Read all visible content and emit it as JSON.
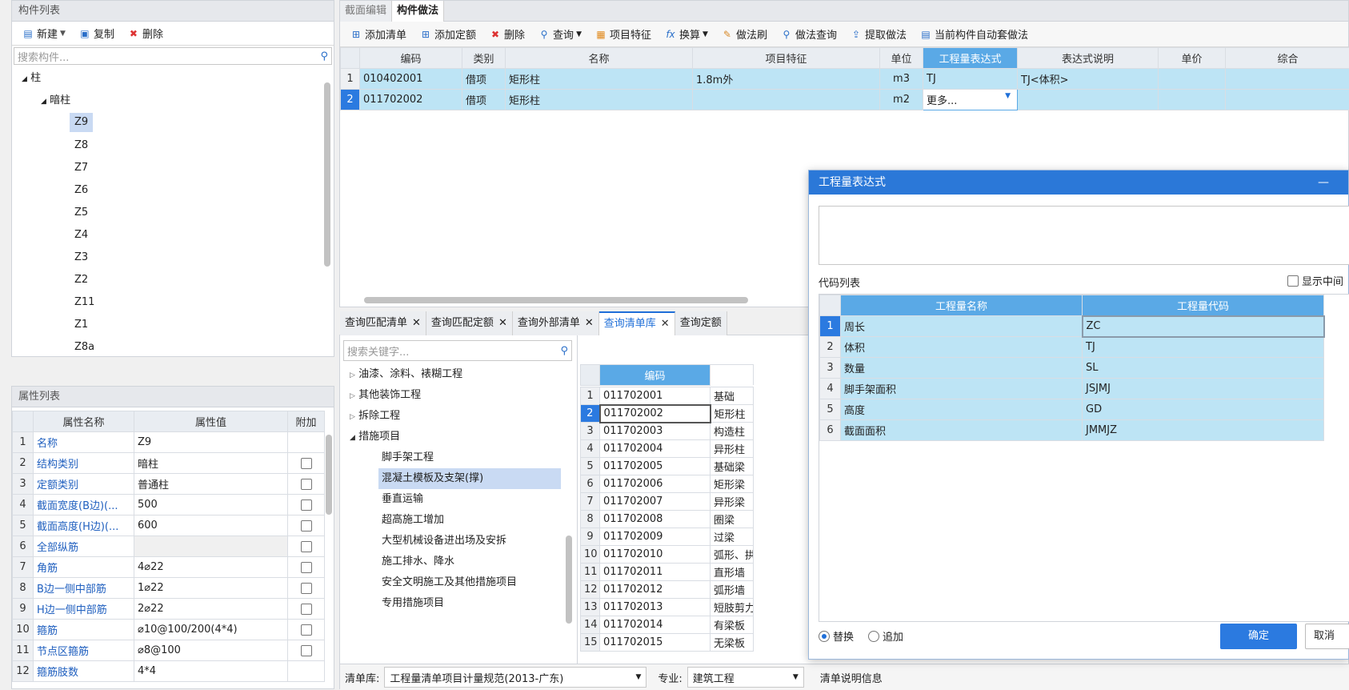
{
  "left_top": {
    "title": "构件列表",
    "new": "新建",
    "copy": "复制",
    "delete": "删除",
    "search_placeholder": "搜索构件...",
    "tree": {
      "root": "柱",
      "sub": "暗柱",
      "items": [
        "Z9",
        "Z8",
        "Z7",
        "Z6",
        "Z5",
        "Z4",
        "Z3",
        "Z2",
        "Z11",
        "Z1",
        "Z8a"
      ]
    }
  },
  "props": {
    "title": "属性列表",
    "headers": [
      "属性名称",
      "属性值",
      "附加"
    ],
    "rows": [
      {
        "n": "1",
        "name": "名称",
        "value": "Z9",
        "check": false
      },
      {
        "n": "2",
        "name": "结构类别",
        "value": "暗柱",
        "check": true
      },
      {
        "n": "3",
        "name": "定额类别",
        "value": "普通柱",
        "check": true
      },
      {
        "n": "4",
        "name": "截面宽度(B边)(...",
        "value": "500",
        "check": true
      },
      {
        "n": "5",
        "name": "截面高度(H边)(...",
        "value": "600",
        "check": true
      },
      {
        "n": "6",
        "name": "全部纵筋",
        "value": "",
        "check": true
      },
      {
        "n": "7",
        "name": "角筋",
        "value": "4⌀22",
        "check": true
      },
      {
        "n": "8",
        "name": "B边一侧中部筋",
        "value": "1⌀22",
        "check": true
      },
      {
        "n": "9",
        "name": "H边一侧中部筋",
        "value": "2⌀22",
        "check": true
      },
      {
        "n": "10",
        "name": "箍筋",
        "value": "⌀10@100/200(4*4)",
        "check": true
      },
      {
        "n": "11",
        "name": "节点区箍筋",
        "value": "⌀8@100",
        "check": true
      },
      {
        "n": "12",
        "name": "箍筋肢数",
        "value": "4*4",
        "check": false
      }
    ]
  },
  "main": {
    "tabs": [
      "截面编辑",
      "构件做法"
    ],
    "toolbar": [
      "添加清单",
      "添加定额",
      "删除",
      "查询",
      "项目特征",
      "换算",
      "做法刷",
      "做法查询",
      "提取做法",
      "当前构件自动套做法"
    ],
    "headers": [
      "编码",
      "类别",
      "名称",
      "项目特征",
      "单位",
      "工程量表达式",
      "表达式说明",
      "单价",
      "综合"
    ],
    "rows": [
      {
        "n": "1",
        "code": "010402001",
        "type": "借项",
        "name": "矩形柱",
        "feature": "1.8m外",
        "unit": "m3",
        "expr": "TJ",
        "desc": "TJ<体积>"
      },
      {
        "n": "2",
        "code": "011702002",
        "type": "借项",
        "name": "矩形柱",
        "feature": "",
        "unit": "m2",
        "expr": "更多...",
        "desc": ""
      }
    ]
  },
  "query": {
    "tabs": [
      "查询匹配清单",
      "查询匹配定额",
      "查询外部清单",
      "查询清单库",
      "查询定额"
    ],
    "search_placeholder": "搜索关键字...",
    "tree": [
      {
        "label": "油漆、涂料、裱糊工程",
        "level": 0,
        "arrow": "▷"
      },
      {
        "label": "其他装饰工程",
        "level": 0,
        "arrow": "▷"
      },
      {
        "label": "拆除工程",
        "level": 0,
        "arrow": "▷"
      },
      {
        "label": "措施项目",
        "level": 0,
        "arrow": "◢"
      },
      {
        "label": "脚手架工程",
        "level": 1,
        "arrow": ""
      },
      {
        "label": "混凝土模板及支架(撑)",
        "level": 1,
        "arrow": ""
      },
      {
        "label": "垂直运输",
        "level": 1,
        "arrow": ""
      },
      {
        "label": "超高施工增加",
        "level": 1,
        "arrow": ""
      },
      {
        "label": "大型机械设备进出场及安拆",
        "level": 1,
        "arrow": ""
      },
      {
        "label": "施工排水、降水",
        "level": 1,
        "arrow": ""
      },
      {
        "label": "安全文明施工及其他措施项目",
        "level": 1,
        "arrow": ""
      },
      {
        "label": "专用措施项目",
        "level": 1,
        "arrow": ""
      }
    ],
    "list_header": "编码",
    "list": [
      {
        "n": "1",
        "code": "011702001",
        "name": "基础"
      },
      {
        "n": "2",
        "code": "011702002",
        "name": "矩形柱"
      },
      {
        "n": "3",
        "code": "011702003",
        "name": "构造柱"
      },
      {
        "n": "4",
        "code": "011702004",
        "name": "异形柱"
      },
      {
        "n": "5",
        "code": "011702005",
        "name": "基础梁"
      },
      {
        "n": "6",
        "code": "011702006",
        "name": "矩形梁"
      },
      {
        "n": "7",
        "code": "011702007",
        "name": "异形梁"
      },
      {
        "n": "8",
        "code": "011702008",
        "name": "圈梁"
      },
      {
        "n": "9",
        "code": "011702009",
        "name": "过梁"
      },
      {
        "n": "10",
        "code": "011702010",
        "name": "弧形、拱形"
      },
      {
        "n": "11",
        "code": "011702011",
        "name": "直形墙"
      },
      {
        "n": "12",
        "code": "011702012",
        "name": "弧形墙"
      },
      {
        "n": "13",
        "code": "011702013",
        "name": "短肢剪力墙"
      },
      {
        "n": "14",
        "code": "011702014",
        "name": "有梁板"
      },
      {
        "n": "15",
        "code": "011702015",
        "name": "无梁板"
      }
    ],
    "footer": {
      "lib_label": "清单库:",
      "lib_value": "工程量清单项目计量规范(2013-广东)",
      "major_label": "专业:",
      "major_value": "建筑工程",
      "info": "清单说明信息"
    }
  },
  "dialog": {
    "title": "工程量表达式",
    "code_list_label": "代码列表",
    "show_mid": "显示中间",
    "headers": [
      "工程量名称",
      "工程量代码"
    ],
    "rows": [
      {
        "n": "1",
        "name": "周长",
        "code": "ZC"
      },
      {
        "n": "2",
        "name": "体积",
        "code": "TJ"
      },
      {
        "n": "3",
        "name": "数量",
        "code": "SL"
      },
      {
        "n": "4",
        "name": "脚手架面积",
        "code": "JSJMJ"
      },
      {
        "n": "5",
        "name": "高度",
        "code": "GD"
      },
      {
        "n": "6",
        "name": "截面面积",
        "code": "JMMJZ"
      }
    ],
    "replace": "替换",
    "append": "追加",
    "ok": "确定",
    "cancel": "取消"
  }
}
